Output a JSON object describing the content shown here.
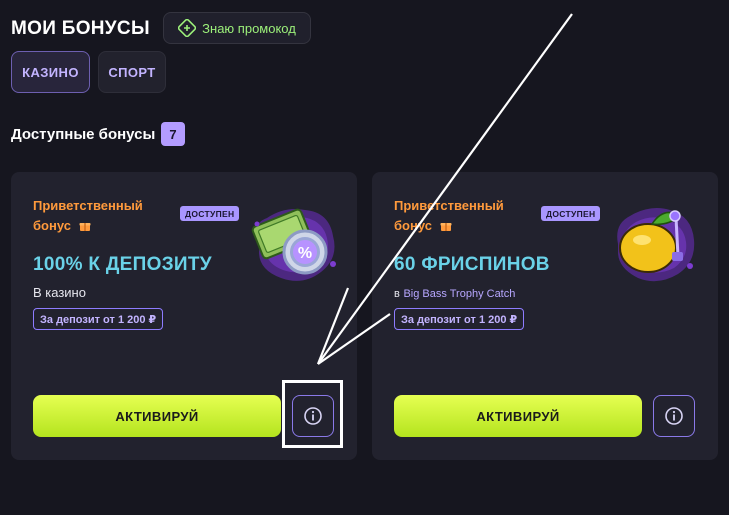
{
  "header": {
    "title": "МОИ БОНУСЫ",
    "promo_label": "Знаю промокод"
  },
  "tabs": [
    {
      "label": "КАЗИНО",
      "active": true
    },
    {
      "label": "СПОРТ",
      "active": false
    }
  ],
  "available": {
    "label": "Доступные бонусы",
    "count": "7"
  },
  "cards": [
    {
      "type_label": "Приветственный бонус",
      "badge": "ДОСТУПЕН",
      "amount": "100% К ДЕПОЗИТУ",
      "description": "В казино",
      "deposit_tag": "За депозит от 1 200 ₽",
      "activate_label": "АКТИВИРУЙ",
      "illustration": "percent-coin-icon"
    },
    {
      "type_label": "Приветственный бонус",
      "badge": "ДОСТУПЕН",
      "amount": "60 ФРИСПИНОВ",
      "description_prefix": "в",
      "description_game": "Big Bass Trophy Catch",
      "deposit_tag": "За депозит от 1 200 ₽",
      "activate_label": "АКТИВИРУЙ",
      "illustration": "lemon-icon"
    }
  ],
  "colors": {
    "background": "#16161f",
    "card": "#22222e",
    "accent_orange": "#ff9a3c",
    "accent_cyan": "#6ad2e8",
    "accent_purple": "#a996ff",
    "activate_green": "#d4f53c"
  }
}
